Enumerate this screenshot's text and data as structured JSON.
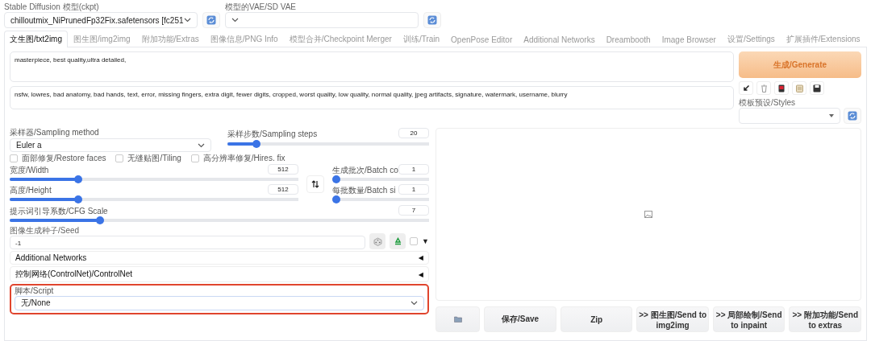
{
  "models": [
    {
      "label": "Stable Diffusion 模型(ckpt)",
      "value": "chilloutmix_NiPrunedFp32Fix.safetensors [fc251"
    },
    {
      "label": "模型的VAE/SD VAE"
    }
  ],
  "tabs": [
    {
      "label": "文生图/txt2img",
      "selected": true
    },
    {
      "label": "图生图/img2img",
      "selected": false
    },
    {
      "label": "附加功能/Extras",
      "selected": false
    },
    {
      "label": "图像信息/PNG Info",
      "selected": false
    },
    {
      "label": "模型合并/Checkpoint Merger",
      "selected": false
    },
    {
      "label": "训练/Train",
      "selected": false
    },
    {
      "label": "OpenPose Editor",
      "selected": false
    },
    {
      "label": "Additional Networks",
      "selected": false
    },
    {
      "label": "Dreambooth",
      "selected": false
    },
    {
      "label": "Image Browser",
      "selected": false
    },
    {
      "label": "设置/Settings",
      "selected": false
    },
    {
      "label": "扩展插件/Extensions",
      "selected": false
    }
  ],
  "prompt": "masterpiece, best quality,ultra detailed,",
  "negative_prompt": "nsfw, lowres, bad anatomy, bad hands, text, error, missing fingers, extra digit, fewer digits, cropped, worst quality, low quality, normal quality, jpeg artifacts, signature, watermark, username, blurry",
  "generate_button": "生成/Generate",
  "styles": {
    "label": "模板预设/Styles"
  },
  "sampler": {
    "label": "采样器/Sampling method",
    "value": "Euler a"
  },
  "steps": {
    "label": "采样步数/Sampling steps",
    "value": "20",
    "level": 0.13
  },
  "checkboxes": [
    {
      "label": "面部修复/Restore faces",
      "checked": false
    },
    {
      "label": "无缝贴图/Tiling",
      "checked": false
    },
    {
      "label": "高分辨率修复/Hires. fix",
      "checked": false
    }
  ],
  "dimension_sliders": [
    {
      "label": "宽度/Width",
      "value": "512",
      "level": 0.23
    },
    {
      "label": "高度/Height",
      "value": "512",
      "level": 0.23
    }
  ],
  "batch_sliders": [
    {
      "label": "生成批次/Batch co",
      "value": "1",
      "level": 0
    },
    {
      "label": "每批数量/Batch si",
      "value": "1",
      "level": 0
    }
  ],
  "cfg": {
    "label": "提示词引导系数/CFG Scale",
    "value": "7",
    "level": 0.21
  },
  "seed": {
    "label": "图像生成种子/Seed",
    "value": "-1",
    "extra_checked": false,
    "toggle": "▼"
  },
  "accordions": [
    {
      "title": "Additional Networks",
      "toggle": "◀"
    },
    {
      "title": "控制网络(ControlNet)/ControlNet",
      "toggle": "◀"
    }
  ],
  "script": {
    "label": "脚本/Script",
    "value": "无/None",
    "highlighted": true
  },
  "output_buttons": [
    {
      "kind": "folder"
    },
    {
      "kind": "text",
      "label": "保存/Save"
    },
    {
      "kind": "text",
      "label": "Zip"
    },
    {
      "kind": "text",
      "label": ">> 图生图/Send to img2img"
    },
    {
      "kind": "text",
      "label": ">> 局部绘制/Send to inpaint"
    },
    {
      "kind": "text",
      "label": ">> 附加功能/Send to extras"
    }
  ]
}
